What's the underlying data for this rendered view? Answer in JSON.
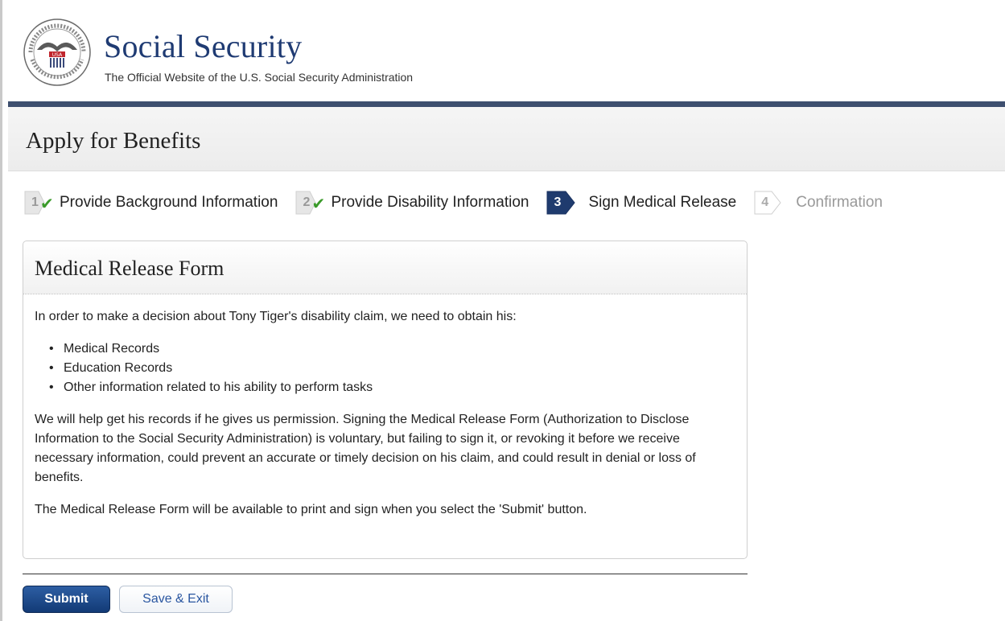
{
  "header": {
    "site_title": "Social Security",
    "tagline": "The Official Website of the U.S. Social Security Administration",
    "seal_icon": "ssa-seal-icon"
  },
  "page": {
    "title": "Apply for Benefits"
  },
  "steps": [
    {
      "number": "1",
      "label": "Provide Background Information",
      "state": "complete"
    },
    {
      "number": "2",
      "label": "Provide Disability Information",
      "state": "complete"
    },
    {
      "number": "3",
      "label": "Sign Medical Release",
      "state": "current"
    },
    {
      "number": "4",
      "label": "Confirmation",
      "state": "pending"
    }
  ],
  "panel": {
    "title": "Medical Release Form",
    "intro": "In order to make a decision about Tony Tiger's disability claim, we need to obtain his:",
    "records": [
      "Medical Records",
      "Education Records",
      "Other information related to his ability to perform tasks"
    ],
    "paragraph": "We will help get his records if he gives us permission. Signing the Medical Release Form (Authorization to Disclose Information to the Social Security Administration) is voluntary, but failing to sign it, or revoking it before we receive necessary information, could prevent an accurate or timely decision on his claim, and could result in denial or loss of benefits.",
    "note": "The Medical Release Form will be available to print and sign when you select the 'Submit' button."
  },
  "actions": {
    "submit_label": "Submit",
    "save_exit_label": "Save & Exit"
  },
  "colors": {
    "brand_navy": "#1f3b73",
    "header_bar": "#3e4f6f",
    "check_green": "#3a9a2a",
    "active_step": "#1f3b6e"
  }
}
